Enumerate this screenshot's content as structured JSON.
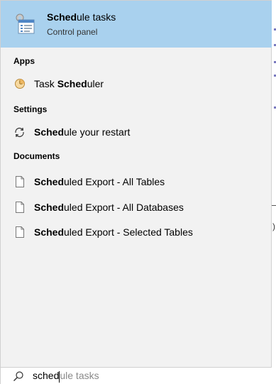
{
  "best_match": {
    "title_bold": "Sched",
    "title_rest": "ule tasks",
    "subtitle": "Control panel"
  },
  "sections": {
    "apps": "Apps",
    "settings": "Settings",
    "documents": "Documents"
  },
  "apps": [
    {
      "prefix": "Task ",
      "bold": "Sched",
      "rest": "uler",
      "icon": "task-scheduler-icon"
    }
  ],
  "settings": [
    {
      "bold": "Sched",
      "rest": "ule your restart",
      "icon": "restart-icon"
    }
  ],
  "documents": [
    {
      "bold": "Sched",
      "rest": "uled Export - All Tables",
      "icon": "document-icon"
    },
    {
      "bold": "Sched",
      "rest": "uled Export - All Databases",
      "icon": "document-icon"
    },
    {
      "bold": "Sched",
      "rest": "uled Export - Selected Tables",
      "icon": "document-icon"
    }
  ],
  "search": {
    "typed": "sched",
    "suggestion": "ule tasks",
    "icon": "search-icon"
  },
  "background": {
    "paren": ")"
  },
  "colors": {
    "highlight": "#a9d1ee",
    "panel": "#f2f2f2",
    "suggestion_text": "#8a8a8a"
  }
}
